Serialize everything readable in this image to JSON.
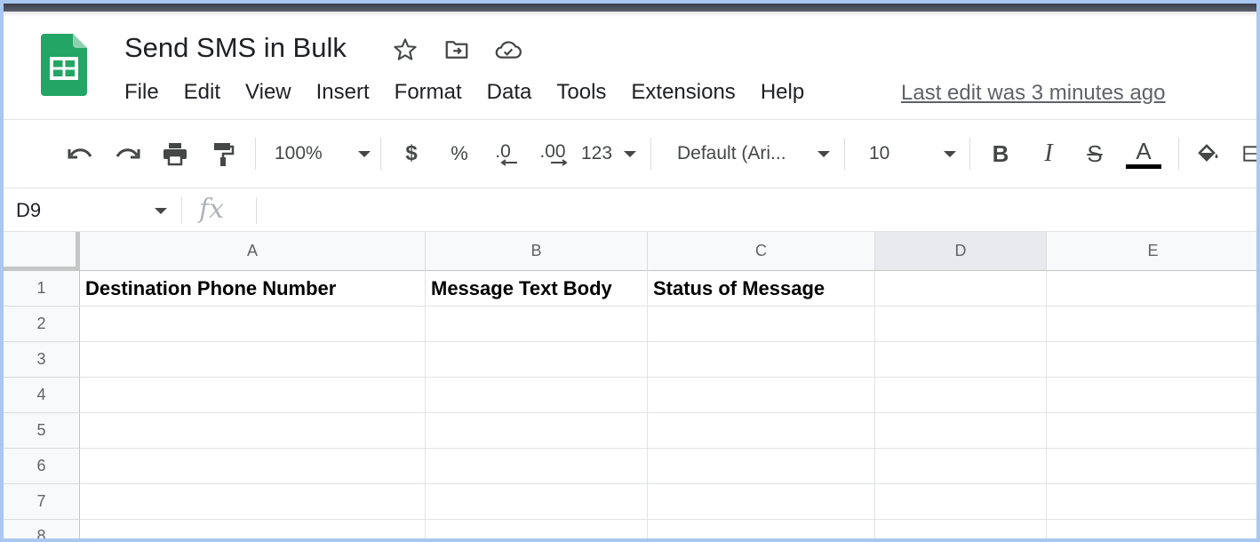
{
  "document": {
    "title": "Send SMS in Bulk",
    "last_edit": "Last edit was 3 minutes ago"
  },
  "title_icons": [
    "star-icon",
    "move-to-folder-icon",
    "cloud-saved-icon"
  ],
  "menu": [
    "File",
    "Edit",
    "View",
    "Insert",
    "Format",
    "Data",
    "Tools",
    "Extensions",
    "Help"
  ],
  "toolbar": {
    "zoom": "100%",
    "currency": "$",
    "percent": "%",
    "decrease_decimal": ".0",
    "increase_decimal": ".00",
    "number_format": "123",
    "font": "Default (Ari...",
    "font_size": "10",
    "bold": "B",
    "italic": "I",
    "strikethrough": "S",
    "text_color": "A"
  },
  "formula_bar": {
    "name_box": "D9",
    "fx": "fx",
    "value": ""
  },
  "grid": {
    "columns": [
      "A",
      "B",
      "C",
      "D",
      "E"
    ],
    "selected_column": "D",
    "rows": [
      "1",
      "2",
      "3",
      "4",
      "5",
      "6",
      "7",
      "8"
    ],
    "row1": [
      "Destination Phone Number",
      "Message Text Body",
      "Status of Message",
      "",
      ""
    ]
  },
  "colors": {
    "sheets_green": "#23a566",
    "accent_frame": "#a9c7f1"
  }
}
